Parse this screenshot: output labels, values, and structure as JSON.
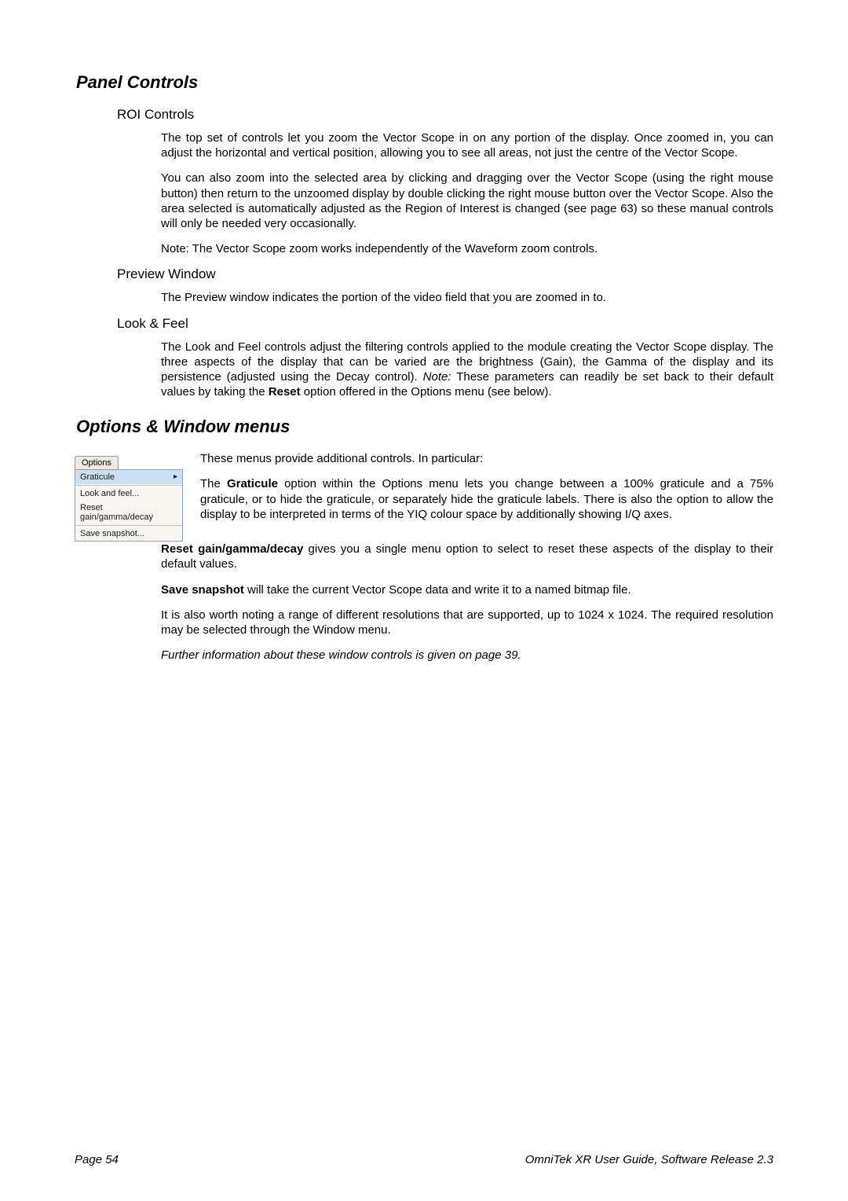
{
  "h1_panel": "Panel Controls",
  "h2_roi": "ROI Controls",
  "roi_p1": "The top set of controls let you zoom the Vector Scope in on any portion of the display. Once zoomed in, you can adjust the horizontal and vertical position, allowing you to see all areas, not just the centre of the Vector Scope.",
  "roi_p2": "You can also zoom into the selected area by clicking and dragging over the Vector Scope (using the right mouse button) then return to the unzoomed display by double clicking the right mouse button over the Vector Scope. Also the area selected is automatically adjusted as the Region of Interest is changed (see page 63) so these manual controls will only be needed very occasionally.",
  "roi_p3": "Note: The Vector Scope zoom works independently of the Waveform zoom controls.",
  "h2_preview": "Preview Window",
  "preview_p1": "The Preview window indicates the portion of the video field that you are zoomed in to.",
  "h2_look": "Look & Feel",
  "look_p1_a": "The Look and Feel controls adjust the filtering controls applied to the module creating the Vector Scope display. The three aspects of the display that can be varied are the brightness (Gain), the Gamma of the display and its persistence (adjusted using the Decay control). ",
  "look_p1_note": "Note:",
  "look_p1_b": " These parameters can readily be set back to their default values by taking the ",
  "look_p1_bold": "Reset",
  "look_p1_c": " option offered in the Options menu (see below).",
  "h1_options": "Options & Window menus",
  "menu": {
    "tab": "Options",
    "item_graticule": "Graticule",
    "arrow": "▸",
    "item_look": "Look and feel...",
    "item_reset": "Reset gain/gamma/decay",
    "item_save": "Save snapshot..."
  },
  "opt_intro": "These menus provide additional controls. In particular:",
  "opt_grat_a": "The ",
  "opt_grat_bold": "Graticule",
  "opt_grat_b": " option within the Options menu lets you change between a 100% graticule and a 75% graticule, or to hide the graticule, or separately hide the graticule labels. There is also the option to allow the display to be interpreted in terms of the YIQ colour space by additionally showing I/Q axes.",
  "opt_reset_bold": "Reset gain/gamma/decay",
  "opt_reset_b": " gives you a single menu option to select to reset these aspects of the display to their default values.",
  "opt_save_bold": "Save snapshot",
  "opt_save_b": " will take the current Vector Scope data and write it to a named bitmap file.",
  "opt_res": "It is also worth noting a range of different resolutions that are supported, up to 1024 x 1024. The required resolution may be selected through the Window menu.",
  "opt_further": "Further information about these window controls is given on page 39.",
  "footer_left": "Page 54",
  "footer_right": "OmniTek XR User Guide, Software Release 2.3"
}
